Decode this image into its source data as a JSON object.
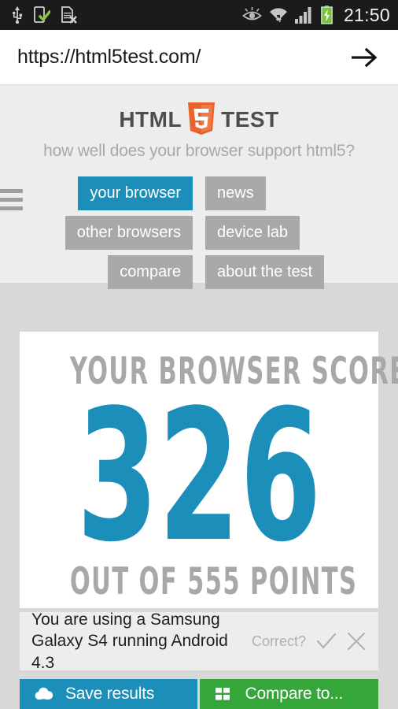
{
  "statusbar": {
    "time": "21:50",
    "left_icons": [
      "usb-icon",
      "device-connected-icon",
      "sim-card-error-icon"
    ],
    "right_icons": [
      "smart-stay-eye-icon",
      "wifi-icon",
      "cellular-signal-icon",
      "battery-charging-icon"
    ],
    "background": "#1b1b1b"
  },
  "browser": {
    "url": "https://html5test.com/",
    "go_label": "go-arrow"
  },
  "header": {
    "menu_icon": "hamburger-icon",
    "logo_left": "HTML",
    "logo_badge": "5",
    "logo_right": "TEST",
    "tagline": "how well does your browser support html5?",
    "logo_color": "#e8622b",
    "background": "#ededed"
  },
  "nav": {
    "rows": [
      {
        "left": {
          "label": "your browser",
          "active": true
        },
        "right": {
          "label": "news",
          "active": false
        }
      },
      {
        "left": {
          "label": "other browsers",
          "active": false
        },
        "right": {
          "label": "device lab",
          "active": false
        }
      },
      {
        "left": {
          "label": "compare",
          "active": false
        },
        "right": {
          "label": "about the test",
          "active": false
        }
      }
    ],
    "active_color": "#1b8fba",
    "inactive_color": "#a9a9a9"
  },
  "score": {
    "title": "YOUR BROWSER SCORES",
    "value": "326",
    "out_of": "OUT OF 555 POINTS",
    "max_points": 555,
    "accent_color": "#1b8fba",
    "label_color": "#a8a8a8"
  },
  "device": {
    "text": "You are using a Samsung Galaxy S4 running Android 4.3",
    "correct_label": "Correct?",
    "confirm_icon": "check-icon",
    "reject_icon": "close-icon"
  },
  "actions": {
    "save": {
      "label": "Save results",
      "icon": "cloud-upload-icon",
      "color": "#1b8fba"
    },
    "compare": {
      "label": "Compare to...",
      "icon": "grid-icon",
      "color": "#35a63a"
    }
  }
}
